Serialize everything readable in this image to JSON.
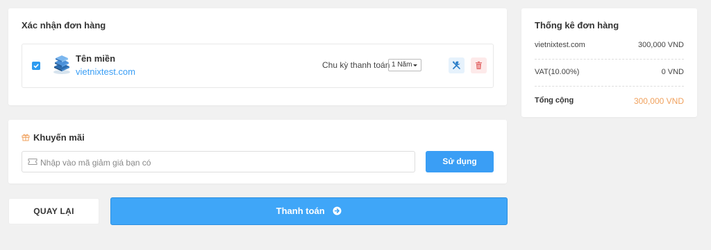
{
  "order": {
    "title": "Xác nhận đơn hàng",
    "item": {
      "checked": true,
      "icon": "server-stack-icon",
      "name": "Tên miền",
      "domain": "vietnixtest.com",
      "cycle_label": "Chu kỳ thanh toán",
      "cycle_value": "1 Năm"
    }
  },
  "promo": {
    "title": "Khuyến mãi",
    "placeholder": "Nhập vào mã giảm giá bạn có",
    "apply_label": "Sử dụng"
  },
  "actions": {
    "back_label": "QUAY LẠI",
    "pay_label": "Thanh toán"
  },
  "summary": {
    "title": "Thống kê đơn hàng",
    "rows": [
      {
        "label": "vietnixtest.com",
        "value": "300,000 VND"
      },
      {
        "label": "VAT(10.00%)",
        "value": "0 VND"
      }
    ],
    "total_label": "Tổng cộng",
    "total_value": "300,000 VND"
  },
  "colors": {
    "accent": "#3a9ef5",
    "total": "#f0a15d",
    "delete": "#e57373"
  }
}
